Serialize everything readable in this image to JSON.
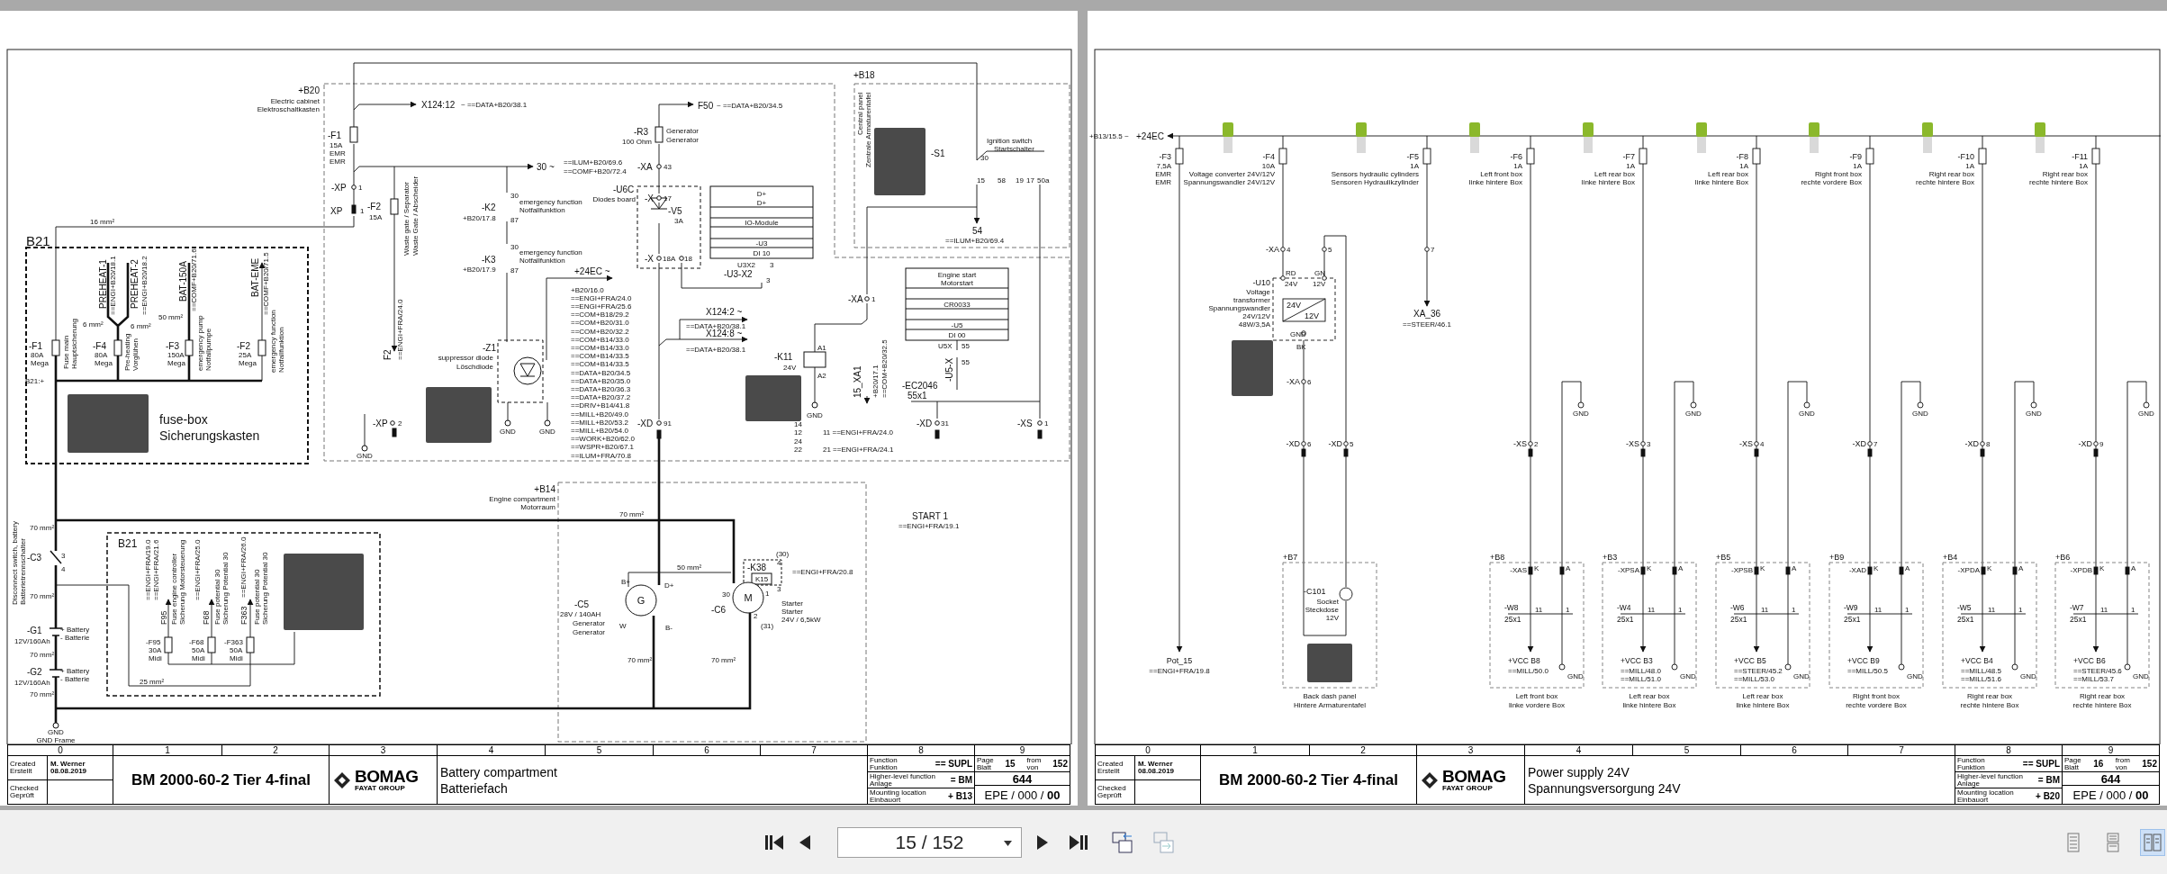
{
  "pages": [
    {
      "schematic": {
        "labels": [
          "+B20",
          "Electric cabinet",
          "Elektroschaltkasten",
          "X124:12",
          "~ ==DATA+B20/38.1",
          "-F1",
          "15A",
          "EMR",
          "EMR",
          "-XP",
          "1",
          "XP",
          "1",
          "-F2",
          "15A",
          "Waste gate / Separator",
          "Waste Gate / Abscheider",
          "30 ~",
          "==ILUM+B20/69.6",
          "==COMF+B20/72.4",
          "-K2",
          "+B20/17.8",
          "30",
          "87",
          "emergency function",
          "Notfallfunktion",
          "-K3",
          "+B20/17.9",
          "30",
          "87",
          "emergency function",
          "Notfallfunktion",
          "-R3",
          "100 Ohm",
          "Generator",
          "Generator",
          "F50",
          "~ ==DATA+B20/34.5",
          "-XA",
          "43",
          "-U6C",
          "Diodes board",
          "-X",
          "17",
          "-V5",
          "3A",
          "-X",
          "18A",
          "18",
          "D+",
          "D+",
          "IO-Module",
          "-U3",
          "DI 10",
          "U3X2",
          "3",
          "-U3-X2",
          "3",
          "+24EC ~",
          "X124:2 ~",
          "==DATA+B20/38.1",
          "X124:8 ~",
          "==DATA+B20/38.1",
          "-XD",
          "91",
          "-K11",
          "24V",
          "A1",
          "A2",
          "GND",
          "-XA",
          "1",
          "15_XA1",
          "+B20/17.1",
          "==COM+B20/32.5",
          "Engine start",
          "Motorstart",
          "CR0033",
          "-U5",
          "DI 00",
          "U5X",
          "55",
          "-U5-X",
          "55",
          "-EC2046",
          "55x1",
          "-XD",
          "31",
          "-XS",
          "1",
          "+B18",
          "Central panel",
          "Zentrale Armaturentafel",
          "-S1",
          "Ignition switch",
          "Startschalter",
          "30",
          "15",
          "58",
          "19",
          "17",
          "50a",
          "B21",
          "54",
          "==ILUM+B20/69.4",
          "16 mm²",
          "PREHEAT-1",
          "==ENGI+B20/18.1",
          "PREHEAT-2",
          "==ENGI+B20/18.2",
          "BAT-150A",
          "==COMF+B20/71.6",
          "BAT-EME",
          "==COMF+B20/71.5",
          "6 mm²",
          "6 mm²",
          "50 mm²",
          "-F1",
          "80A",
          "Mega",
          "Fuse main",
          "Hauptsicherung",
          "-F4",
          "80A",
          "Mega",
          "Pre-heating",
          "Vorglühen",
          "-F3",
          "150A",
          "Mega",
          "emergency pump",
          "Notfallpumpe",
          "-F2",
          "25A",
          "Mega",
          "emergency function",
          "Notfallfunktion",
          "B21:+",
          "fuse-box",
          "Sicherungskasten",
          "F2",
          "==ENGI+FRA/24.0",
          "-Z1",
          "suppressor diode",
          "Löschdiode",
          "-XP",
          "2",
          "GND",
          "GND",
          "GND",
          "START 1",
          "==ENGI+FRA/19.1",
          "+B14",
          "Engine compartment",
          "Motorraum",
          "70 mm²",
          "50 mm²",
          "70 mm²",
          "70 mm²",
          "B+",
          "D+",
          "G",
          "W",
          "B-",
          "-C5",
          "28V / 140AH",
          "Generator",
          "Generator",
          "M",
          "30",
          "-C6",
          "1",
          "2",
          "(31)",
          "-K38",
          "K15",
          "(30)",
          "4",
          "3",
          "==ENGI+FRA/20.8",
          "Starter",
          "Starter",
          "24V / 6,5kW",
          "-C3",
          "3",
          "4",
          "Disconnect switch, battery",
          "Batterietrennschalter",
          "70 mm²",
          "70 mm²",
          "-G1",
          "12V/160Ah",
          "+ Battery",
          "- Batterie",
          "70 mm²",
          "-G2",
          "12V/160Ah",
          "+ Battery",
          "- Batterie",
          "70 mm²",
          "GND",
          "GND Frame",
          "B21",
          "==ENGI+FRA/19.0",
          "==ENGI+FRA/21.6",
          "F95",
          "Fuse engine controller",
          "Sicherung Motorsteuerung",
          "==ENGI+FRA/25.0",
          "F68",
          "Fuse potential 30",
          "Sicherung Potential 30",
          "==ENGI+FRA/26.0",
          "F363",
          "Fuse potential 30",
          "Sicherung Potential 30",
          "-F95",
          "30A",
          "Midi",
          "-F68",
          "50A",
          "Midi",
          "-F363",
          "50A",
          "Midi",
          "25 mm²",
          "14",
          "12",
          "11 ==ENGI+FRA/24.0",
          "24",
          "22",
          "21 ==ENGI+FRA/24.1"
        ],
        "reference_list": [
          "+B20/16.0",
          "==ENGI+FRA/24.0",
          "==ENGI+FRA/25.6",
          "==COM+B18/29.2",
          "==COM+B20/31.0",
          "==COM+B20/32.2",
          "==COM+B14/33.0",
          "==COM+B14/33.0",
          "==COM+B14/33.5",
          "==COM+B14/33.5",
          "==DATA+B20/34.5",
          "==DATA+B20/35.0",
          "==DATA+B20/36.3",
          "==DATA+B20/37.2",
          "==DRIV+B14/41.8",
          "==MILL+B20/49.0",
          "==MILL+B20/53.2",
          "==MILL+B20/54.0",
          "==WORK+B20/62.0",
          "==WSPR+B20/67.1",
          "==ILUM+FRA/70.8"
        ]
      },
      "columns": [
        "0",
        "1",
        "2",
        "3",
        "4",
        "5",
        "6",
        "7",
        "8",
        "9"
      ],
      "title_block": {
        "created_label": [
          "Created",
          "Erstellt"
        ],
        "checked_label": [
          "Checked",
          "Geprüft"
        ],
        "author": "M. Werner",
        "date": "08.08.2019",
        "project": "BM 2000-60-2 Tier 4-final",
        "logo": "BOMAG",
        "logo_subtitle": "FAYAT GROUP",
        "description": [
          "Battery compartment",
          "Batteriefach"
        ],
        "fields": [
          {
            "label": [
              "Function",
              "Funktion"
            ],
            "value": "== SUPL"
          },
          {
            "label": [
              "Higher-level function",
              "Anlage"
            ],
            "value": "= BM"
          },
          {
            "label": [
              "Mounting location",
              "Einbauort"
            ],
            "value": "+ B13"
          }
        ],
        "page_label": [
          "Page",
          "Blatt"
        ],
        "page": "15",
        "from_label": [
          "from",
          "von"
        ],
        "total": "152",
        "drawing_number": "644",
        "revision": "EPE / 000 / **00**"
      }
    },
    {
      "schematic": {
        "labels": [
          "+B13/15.5 ~",
          "+24EC",
          "-XA",
          "4",
          "5",
          "7",
          "-U10",
          "Voltage",
          "transformer",
          "Spannungswandler",
          "24V/12V",
          "48W/3,5A",
          "RD",
          "24V",
          "GN",
          "12V",
          "24V",
          "12V",
          "GND",
          "BK",
          "-XA",
          "6",
          "XA_36",
          "==STEER/46.1",
          "Pot_15",
          "==ENGI+FRA/19.8",
          "+B7",
          "-C101",
          "Socket",
          "Steckdose",
          "12V",
          "Back dash panel",
          "Hintere Armaturentafel"
        ],
        "fuses": [
          {
            "name": "-F3",
            "rating": "7,5A",
            "lines": [
              "EMR",
              "EMR"
            ]
          },
          {
            "name": "-F4",
            "rating": "10A",
            "lines": [
              "Voltage converter 24V/12V",
              "Spannungswandler 24V/12V"
            ]
          },
          {
            "name": "-F5",
            "rating": "1A",
            "lines": [
              "Sensors hydraulic cylinders",
              "Sensoren Hydraulikzylinder"
            ]
          },
          {
            "name": "-F6",
            "rating": "1A",
            "lines": [
              "Left front box",
              "linke hintere Box"
            ]
          },
          {
            "name": "-F7",
            "rating": "1A",
            "lines": [
              "Left rear box",
              "linke hintere Box"
            ]
          },
          {
            "name": "-F8",
            "rating": "1A",
            "lines": [
              "Left rear box",
              "linke hintere Box"
            ]
          },
          {
            "name": "-F9",
            "rating": "1A",
            "lines": [
              "Right front box",
              "rechte vordere Box"
            ]
          },
          {
            "name": "-F10",
            "rating": "1A",
            "lines": [
              "Right rear box",
              "rechte hintere Box"
            ]
          },
          {
            "name": "-F11",
            "rating": "1A",
            "lines": [
              "Right rear box",
              "rechte hintere Box"
            ]
          }
        ],
        "gnd_labels": [
          "GND",
          "GND",
          "GND",
          "GND",
          "GND",
          "GND"
        ],
        "connectors": [
          {
            "name": "-XD",
            "pin": "6"
          },
          {
            "name": "-XD",
            "pin": "5"
          },
          {
            "name": "-XS",
            "pin": "2"
          },
          {
            "name": "-XS",
            "pin": "3"
          },
          {
            "name": "-XS",
            "pin": "4"
          },
          {
            "name": "-XD",
            "pin": "7"
          },
          {
            "name": "-XD",
            "pin": "8"
          },
          {
            "name": "-XD",
            "pin": "9"
          }
        ],
        "boxes": [
          {
            "location": "+B8",
            "connector": "-XAS",
            "pins": [
              "K",
              "A",
              "11",
              "1"
            ],
            "cable": "-W8",
            "cable_size": "25x1",
            "supply": "+VCC B8",
            "refs": [
              "==MILL/50.0"
            ],
            "gnd": "GND",
            "lines": [
              "Left front box",
              "linke vordere Box"
            ]
          },
          {
            "location": "+B3",
            "connector": "-XPSA",
            "pins": [
              "K",
              "A",
              "11",
              "1"
            ],
            "cable": "-W4",
            "cable_size": "25x1",
            "supply": "+VCC B3",
            "refs": [
              "==MILL/48.0",
              "==MILL/51.0"
            ],
            "gnd": "GND",
            "lines": [
              "Left rear box",
              "linke hintere Box"
            ]
          },
          {
            "location": "+B5",
            "connector": "-XPSB",
            "pins": [
              "K",
              "A",
              "11",
              "1"
            ],
            "cable": "-W6",
            "cable_size": "25x1",
            "supply": "+VCC B5",
            "refs": [
              "==STEER/45.2",
              "==MILL/53.0"
            ],
            "gnd": "GND",
            "lines": [
              "Left rear box",
              "linke hintere Box"
            ]
          },
          {
            "location": "+B9",
            "connector": "-XAD",
            "pins": [
              "K",
              "A",
              "11",
              "1"
            ],
            "cable": "-W9",
            "cable_size": "25x1",
            "supply": "+VCC B9",
            "refs": [
              "==MILL/50.5"
            ],
            "gnd": "GND",
            "lines": [
              "Right front box",
              "rechte vordere Box"
            ]
          },
          {
            "location": "+B4",
            "connector": "-XPDA",
            "pins": [
              "K",
              "A",
              "11",
              "1"
            ],
            "cable": "-W5",
            "cable_size": "25x1",
            "supply": "+VCC B4",
            "refs": [
              "==MILL/48.5",
              "==MILL/51.6"
            ],
            "gnd": "GND",
            "lines": [
              "Right rear box",
              "rechte hintere Box"
            ]
          },
          {
            "location": "+B6",
            "connector": "-XPDB",
            "pins": [
              "K",
              "A",
              "11",
              "1"
            ],
            "cable": "-W7",
            "cable_size": "25x1",
            "supply": "+VCC B6",
            "refs": [
              "==STEER/45.6",
              "==MILL/53.7"
            ],
            "gnd": "GND",
            "lines": [
              "Right rear box",
              "rechte hintere Box"
            ]
          }
        ]
      },
      "columns": [
        "0",
        "1",
        "2",
        "3",
        "4",
        "5",
        "6",
        "7",
        "8",
        "9"
      ],
      "title_block": {
        "created_label": [
          "Created",
          "Erstellt"
        ],
        "checked_label": [
          "Checked",
          "Geprüft"
        ],
        "author": "M. Werner",
        "date": "08.08.2019",
        "project": "BM 2000-60-2 Tier 4-final",
        "logo": "BOMAG",
        "logo_subtitle": "FAYAT GROUP",
        "description": [
          "Power supply 24V",
          "Spannungsversorgung 24V"
        ],
        "fields": [
          {
            "label": [
              "Function",
              "Funktion"
            ],
            "value": "== SUPL"
          },
          {
            "label": [
              "Higher-level function",
              "Anlage"
            ],
            "value": "= BM"
          },
          {
            "label": [
              "Mounting location",
              "Einbauort"
            ],
            "value": "+ B20"
          }
        ],
        "page_label": [
          "Page",
          "Blatt"
        ],
        "page": "16",
        "from_label": [
          "from",
          "von"
        ],
        "total": "152",
        "drawing_number": "644",
        "revision": "EPE / 000 / **00**"
      }
    }
  ],
  "toolbar": {
    "page_field": "15 / 152",
    "view_modes": [
      {
        "selected": false
      },
      {
        "selected": false
      },
      {
        "selected": true
      }
    ]
  }
}
